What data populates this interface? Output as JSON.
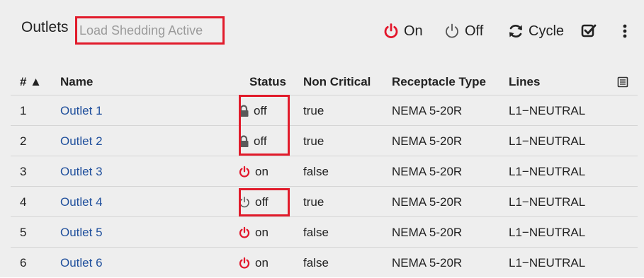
{
  "header": {
    "title": "Outlets",
    "subtitle": "Load Shedding Active",
    "toolbar": {
      "on_label": "On",
      "off_label": "Off",
      "cycle_label": "Cycle"
    }
  },
  "table": {
    "columns": {
      "num": "# ▲",
      "name": "Name",
      "status": "Status",
      "non_critical": "Non Critical",
      "receptacle_type": "Receptacle Type",
      "lines": "Lines"
    },
    "rows": [
      {
        "num": "1",
        "name": "Outlet 1",
        "status": "off",
        "status_icon": "lock-icon",
        "non_critical": "true",
        "receptacle_type": "NEMA 5-20R",
        "lines": "L1−NEUTRAL"
      },
      {
        "num": "2",
        "name": "Outlet 2",
        "status": "off",
        "status_icon": "lock-icon",
        "non_critical": "true",
        "receptacle_type": "NEMA 5-20R",
        "lines": "L1−NEUTRAL"
      },
      {
        "num": "3",
        "name": "Outlet 3",
        "status": "on",
        "status_icon": "power-on-icon",
        "non_critical": "false",
        "receptacle_type": "NEMA 5-20R",
        "lines": "L1−NEUTRAL"
      },
      {
        "num": "4",
        "name": "Outlet 4",
        "status": "off",
        "status_icon": "power-off-icon",
        "non_critical": "true",
        "receptacle_type": "NEMA 5-20R",
        "lines": "L1−NEUTRAL"
      },
      {
        "num": "5",
        "name": "Outlet 5",
        "status": "on",
        "status_icon": "power-on-icon",
        "non_critical": "false",
        "receptacle_type": "NEMA 5-20R",
        "lines": "L1−NEUTRAL"
      },
      {
        "num": "6",
        "name": "Outlet 6",
        "status": "on",
        "status_icon": "power-on-icon",
        "non_critical": "false",
        "receptacle_type": "NEMA 5-20R",
        "lines": "L1−NEUTRAL"
      }
    ]
  },
  "colors": {
    "power_on": "#e3162b",
    "power_off": "#555555",
    "lock": "#5a5a5a",
    "link": "#1f4f9c",
    "highlight_box": "#e11b2b"
  }
}
